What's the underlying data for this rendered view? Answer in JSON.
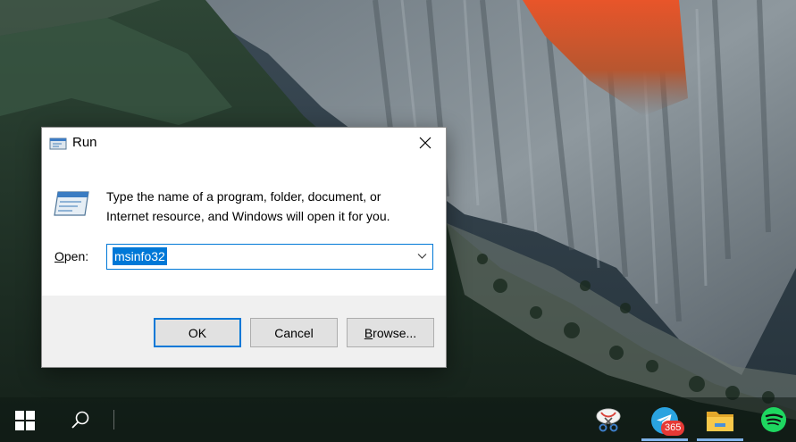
{
  "dialog": {
    "title": "Run",
    "description_line1": "Type the name of a program, folder, document, or",
    "description_line2": "Internet resource, and Windows will open it for you.",
    "open_label_accel": "O",
    "open_label_rest": "pen:",
    "command_value": "msinfo32",
    "buttons": {
      "ok": "OK",
      "cancel": "Cancel",
      "browse_accel": "B",
      "browse_rest": "rowse..."
    },
    "icons": {
      "title": "run-icon",
      "main": "run-icon",
      "close": "close-icon",
      "dropdown": "chevron-down-icon"
    },
    "colors": {
      "accent": "#0078d7",
      "button_face": "#e1e1e1",
      "footer_bg": "#f0f0f0"
    }
  },
  "taskbar": {
    "telegram_badge": "365",
    "icons": [
      "windows-logo-icon",
      "search-icon",
      "snipping-tool-icon",
      "telegram-icon",
      "file-explorer-icon",
      "spotify-icon"
    ]
  }
}
